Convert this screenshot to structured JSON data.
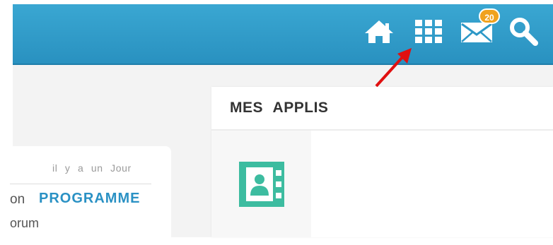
{
  "header": {
    "icons": [
      "home-icon",
      "apps-grid-icon",
      "mail-icon",
      "search-icon"
    ],
    "notification_count": "20",
    "bar_color": "#2f9ccb",
    "badge_color": "#f0a21e"
  },
  "annotation": {
    "icon": "red-arrow-icon",
    "color": "#e01010"
  },
  "feed_card": {
    "time": "il y a un Jour",
    "prefix": "on",
    "link": "PROGRAMME",
    "subtext": "orum"
  },
  "apps_panel": {
    "title": "MES APPLIS",
    "apps": [
      {
        "icon": "contacts-icon",
        "color": "#3dbca0"
      }
    ]
  }
}
